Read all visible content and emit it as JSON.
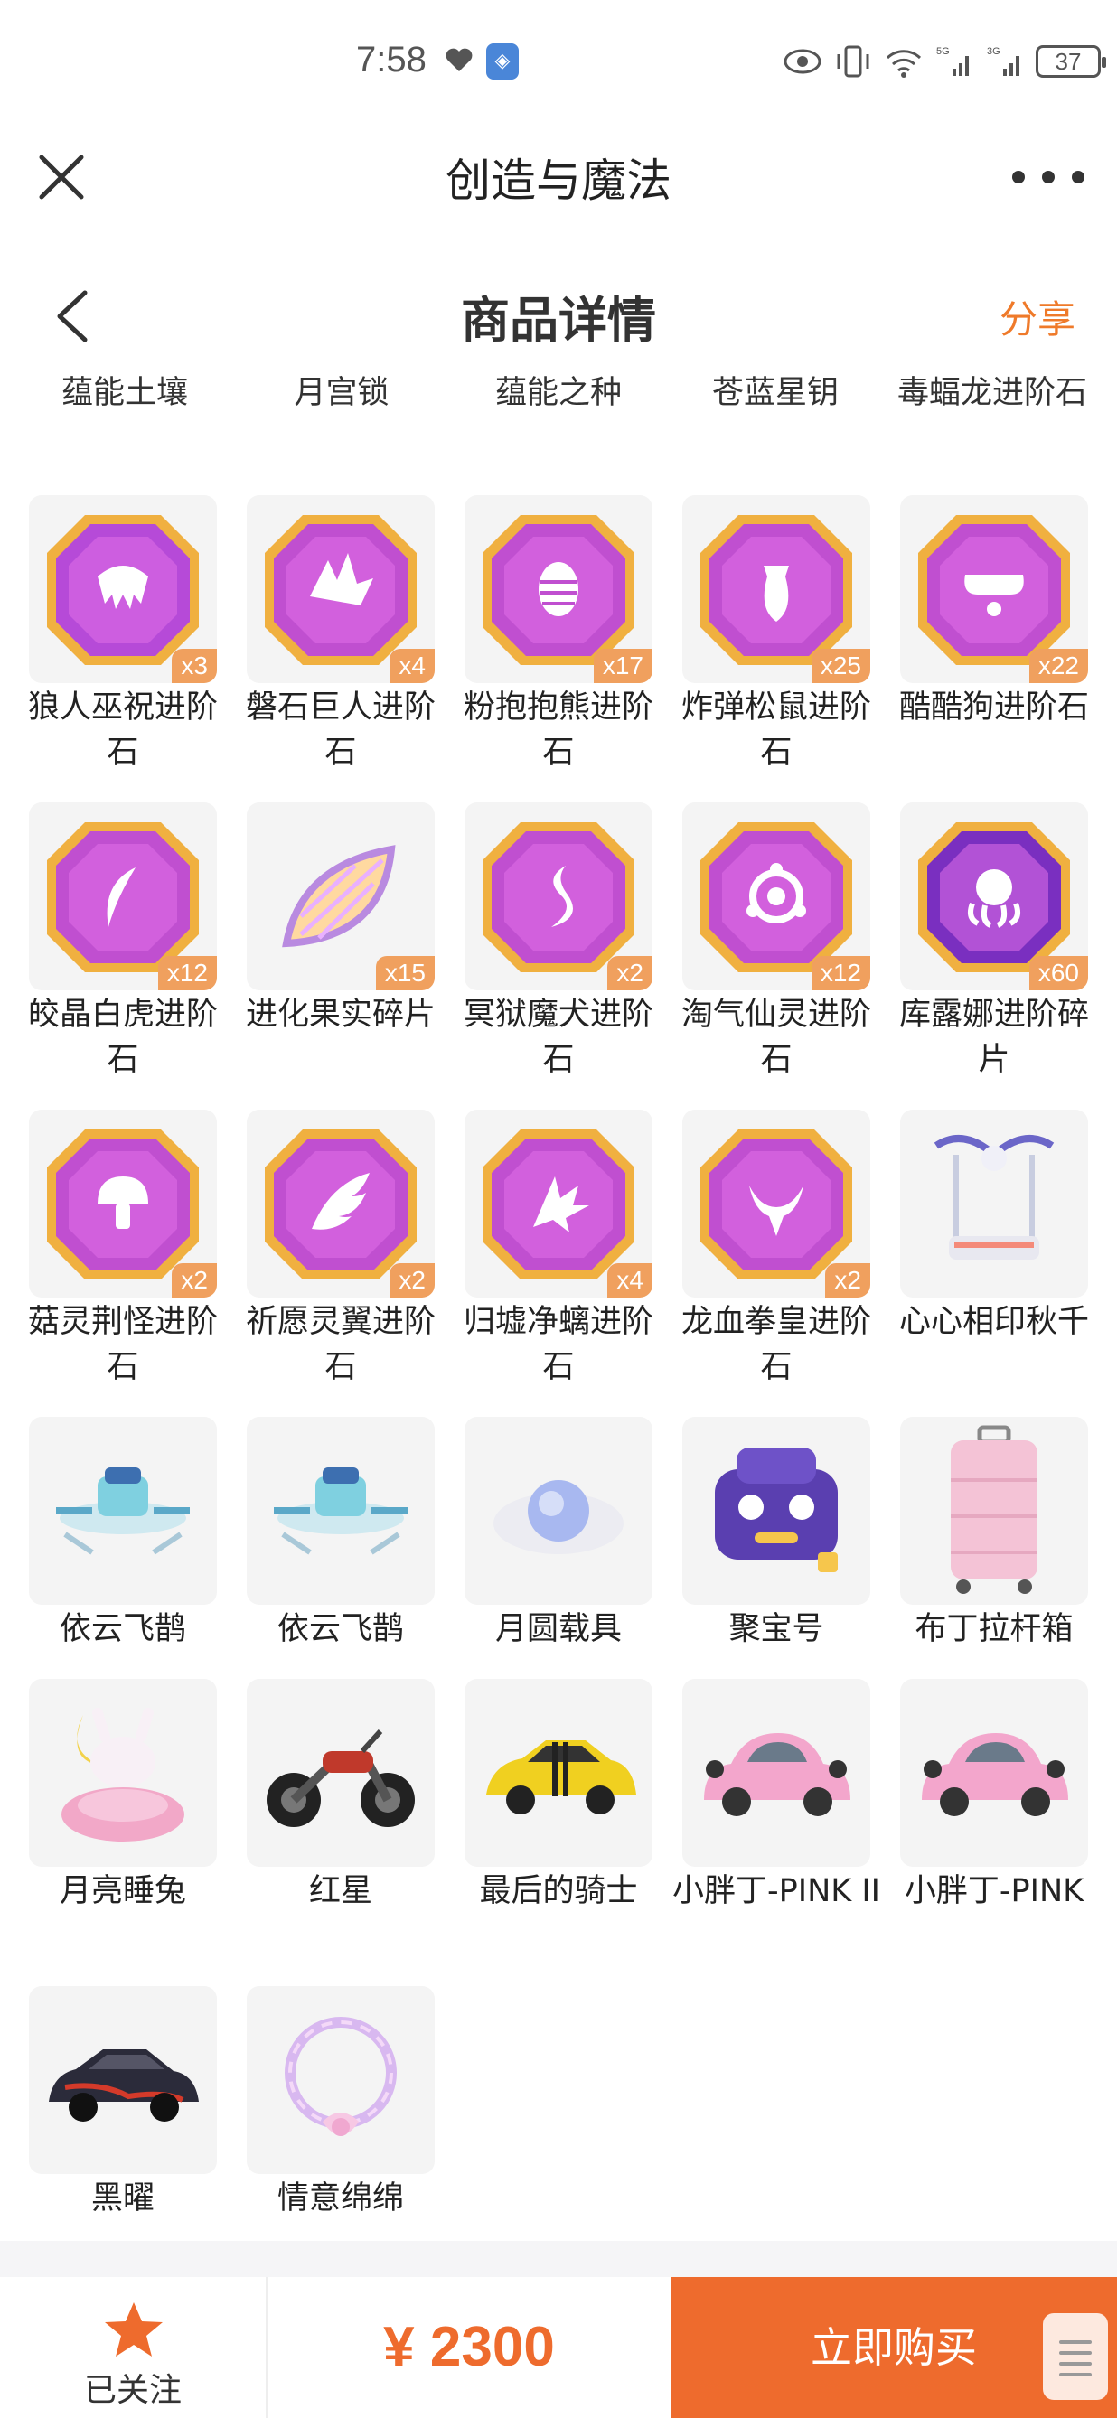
{
  "status_bar": {
    "time": "7:58",
    "battery": "37"
  },
  "header": {
    "title": "创造与魔法"
  },
  "subheader": {
    "title": "商品详情",
    "share": "分享"
  },
  "top_labels": [
    "蕴能土壤",
    "月宫锁",
    "蕴能之种",
    "苍蓝星钥",
    "毒蝠龙进阶石"
  ],
  "items": [
    {
      "name": "狼人巫祝进阶石",
      "qty": "x3",
      "icon": "wolf-mask-gem-icon",
      "color": "#b64ad8"
    },
    {
      "name": "磐石巨人进阶石",
      "qty": "x4",
      "icon": "crystal-shard-gem-icon",
      "color": "#c04fd0"
    },
    {
      "name": "粉抱抱熊进阶石",
      "qty": "x17",
      "icon": "egg-gem-icon",
      "color": "#c04fd0"
    },
    {
      "name": "炸弹松鼠进阶石",
      "qty": "x25",
      "icon": "acorn-gem-icon",
      "color": "#c04fd0"
    },
    {
      "name": "酷酷狗进阶石",
      "qty": "x22",
      "icon": "goggles-gem-icon",
      "color": "#c04fd0"
    },
    {
      "name": "皎晶白虎进阶石",
      "qty": "x12",
      "icon": "claw-gem-icon",
      "color": "#c04fd0"
    },
    {
      "name": "进化果实碎片",
      "qty": "x15",
      "icon": "fruit-slice-icon",
      "color": "#c9a2e6"
    },
    {
      "name": "冥狱魔犬进阶石",
      "qty": "x2",
      "icon": "flame-gem-icon",
      "color": "#c04fd0"
    },
    {
      "name": "淘气仙灵进阶石",
      "qty": "x12",
      "icon": "fairy-ring-gem-icon",
      "color": "#c04fd0"
    },
    {
      "name": "库露娜进阶碎片",
      "qty": "x60",
      "icon": "octopus-gem-icon",
      "color": "#7a2fc0"
    },
    {
      "name": "菇灵荆怪进阶石",
      "qty": "x2",
      "icon": "mushroom-gem-icon",
      "color": "#c04fd0"
    },
    {
      "name": "祈愿灵翼进阶石",
      "qty": "x2",
      "icon": "wing-gem-icon",
      "color": "#c04fd0"
    },
    {
      "name": "归墟净螭进阶石",
      "qty": "x4",
      "icon": "dragon-fin-gem-icon",
      "color": "#c04fd0"
    },
    {
      "name": "龙血拳皇进阶石",
      "qty": "x2",
      "icon": "horned-skull-gem-icon",
      "color": "#c04fd0"
    },
    {
      "name": "心心相印秋千",
      "qty": "",
      "icon": "swing-icon",
      "color": "#a0b4d8"
    },
    {
      "name": "依云飞鹊",
      "qty": "",
      "icon": "flying-vehicle-icon",
      "color": "#7fd0e0"
    },
    {
      "name": "依云飞鹊",
      "qty": "",
      "icon": "flying-vehicle-icon",
      "color": "#7fd0e0"
    },
    {
      "name": "月圆载具",
      "qty": "",
      "icon": "moon-cloud-icon",
      "color": "#a8b8f0"
    },
    {
      "name": "聚宝号",
      "qty": "",
      "icon": "purple-robot-icon",
      "color": "#5a3fb0"
    },
    {
      "name": "布丁拉杆箱",
      "qty": "",
      "icon": "suitcase-icon",
      "color": "#f4c3d6"
    },
    {
      "name": "月亮睡兔",
      "qty": "",
      "icon": "moon-rabbit-icon",
      "color": "#f2a8c8"
    },
    {
      "name": "红星",
      "qty": "",
      "icon": "motorcycle-icon",
      "color": "#555555"
    },
    {
      "name": "最后的骑士",
      "qty": "",
      "icon": "yellow-car-icon",
      "color": "#f0d020"
    },
    {
      "name": "小胖丁-PINK II",
      "qty": "",
      "icon": "pink-beetle-car-icon",
      "color": "#f3a6cc"
    },
    {
      "name": "小胖丁-PINK",
      "qty": "",
      "icon": "pink-beetle-car-icon",
      "color": "#f3a6cc"
    },
    {
      "name": "黑曜",
      "qty": "",
      "icon": "black-car-icon",
      "color": "#2b2b3a"
    },
    {
      "name": "情意绵绵",
      "qty": "",
      "icon": "wreath-icon",
      "color": "#d8b8f0"
    }
  ],
  "bottom": {
    "follow_label": "已关注",
    "price": "¥ 2300",
    "buy_label": "立即购买"
  },
  "colors": {
    "accent": "#ee6b2d",
    "qty_badge": "#f0a05e",
    "share": "#ef7a2a"
  }
}
